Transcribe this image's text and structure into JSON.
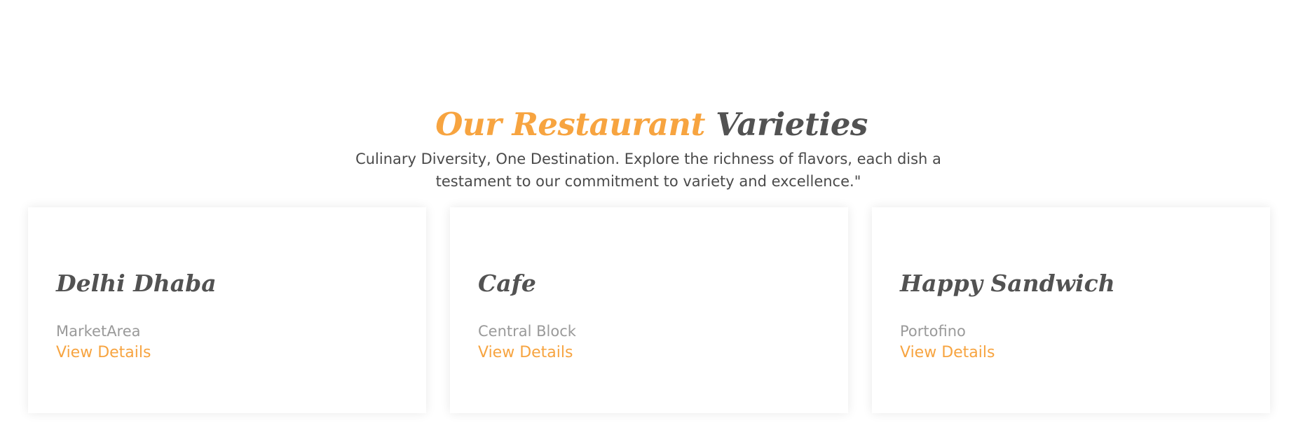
{
  "section": {
    "title_accent": "Our Restaurant",
    "title_rest": "Varieties",
    "subtitle": "Culinary Diversity, One Destination. Explore the richness of flavors, each dish a testament to our commitment to variety and excellence.\""
  },
  "restaurants": [
    {
      "name": "Delhi Dhaba",
      "location": "MarketArea",
      "link_label": "View Details"
    },
    {
      "name": "Cafe",
      "location": "Central Block",
      "link_label": "View Details"
    },
    {
      "name": "Happy Sandwich",
      "location": "Portofino",
      "link_label": "View Details"
    }
  ],
  "colors": {
    "accent": "#f7a440",
    "heading": "#525252",
    "muted": "#9a9a9a"
  }
}
